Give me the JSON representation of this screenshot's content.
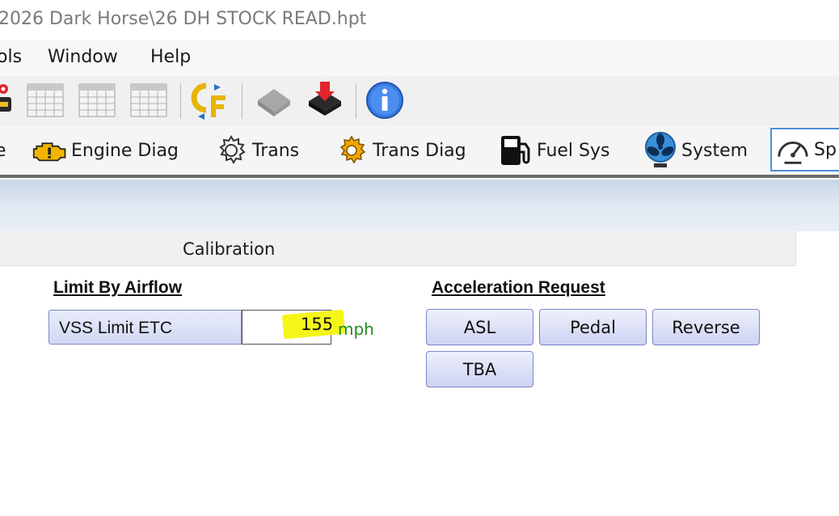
{
  "window": {
    "title": "2026 Dark Horse\\26 DH STOCK READ.hpt"
  },
  "menu": {
    "items": [
      "ols",
      "Window",
      "Help"
    ]
  },
  "toolbar": {
    "icons": [
      "chip-fire-icon",
      "table-icon",
      "table-icon",
      "table-icon",
      "cf-convert-icon",
      "chip-grey-icon",
      "chip-write-icon",
      "info-icon"
    ]
  },
  "category_tabs": [
    {
      "label": "e",
      "icon": "engine-icon"
    },
    {
      "label": "Engine Diag",
      "icon": "engine-warning-icon"
    },
    {
      "label": "Trans",
      "icon": "gear-icon"
    },
    {
      "label": "Trans Diag",
      "icon": "gear-orange-icon"
    },
    {
      "label": "Fuel Sys",
      "icon": "fuel-pump-icon"
    },
    {
      "label": "System",
      "icon": "fan-icon"
    },
    {
      "label": "Sp",
      "icon": "speedometer-icon"
    }
  ],
  "calibration": {
    "header": "Calibration"
  },
  "limit_by_airflow": {
    "title": "Limit By Airflow",
    "vss_label": "VSS Limit ETC",
    "vss_value": "155",
    "vss_unit": "mph",
    "highlight_color": "#f5f51a"
  },
  "acceleration_request": {
    "title": "Acceleration Request",
    "buttons": [
      "ASL",
      "Pedal",
      "Reverse",
      "TBA"
    ]
  }
}
